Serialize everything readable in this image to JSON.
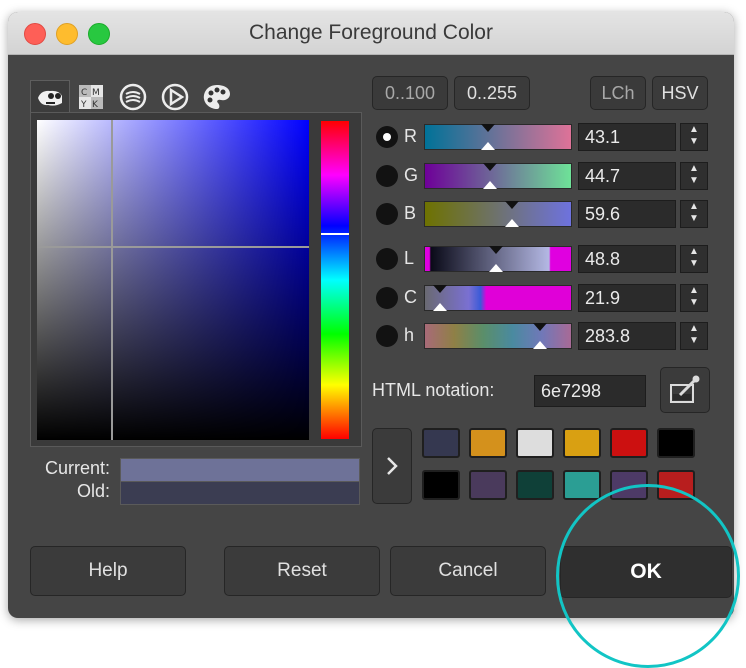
{
  "window": {
    "title": "Change Foreground Color"
  },
  "tabs": [
    {
      "name": "gimp-icon"
    },
    {
      "name": "cmyk-icon",
      "label": "CMYK"
    },
    {
      "name": "watercolor-icon"
    },
    {
      "name": "wheel-icon"
    },
    {
      "name": "palette-icon"
    }
  ],
  "range_buttons": {
    "r100": "0..100",
    "r255": "0..255"
  },
  "model_buttons": {
    "lch": "LCh",
    "hsv": "HSV"
  },
  "channels": [
    {
      "letter": "R",
      "value": "43.1",
      "pos": 0.431,
      "selected": true
    },
    {
      "letter": "G",
      "value": "44.7",
      "pos": 0.447,
      "selected": false
    },
    {
      "letter": "B",
      "value": "59.6",
      "pos": 0.596,
      "selected": false
    },
    {
      "letter": "L",
      "value": "48.8",
      "pos": 0.488,
      "selected": false
    },
    {
      "letter": "C",
      "value": "21.9",
      "pos": 0.1,
      "selected": false
    },
    {
      "letter": "h",
      "value": "283.8",
      "pos": 0.788,
      "selected": false
    }
  ],
  "html_notation": {
    "label": "HTML notation:",
    "value": "6e7298"
  },
  "swatches": {
    "current_label": "Current:",
    "old_label": "Old:",
    "current_color": "#6e7298",
    "old_color": "#3b3d52"
  },
  "history": [
    "#353850",
    "#d4911c",
    "#dddddd",
    "#d9a012",
    "#cc1010",
    "#000000",
    "#000000",
    "#4a3a5c",
    "#0f4038",
    "#2b9e94",
    "#4d3a66",
    "#b81e1e"
  ],
  "buttons": {
    "help": "Help",
    "reset": "Reset",
    "cancel": "Cancel",
    "ok": "OK"
  },
  "colors": {
    "highlight_ring": "#12c5c5",
    "window_bg": "#454545"
  }
}
